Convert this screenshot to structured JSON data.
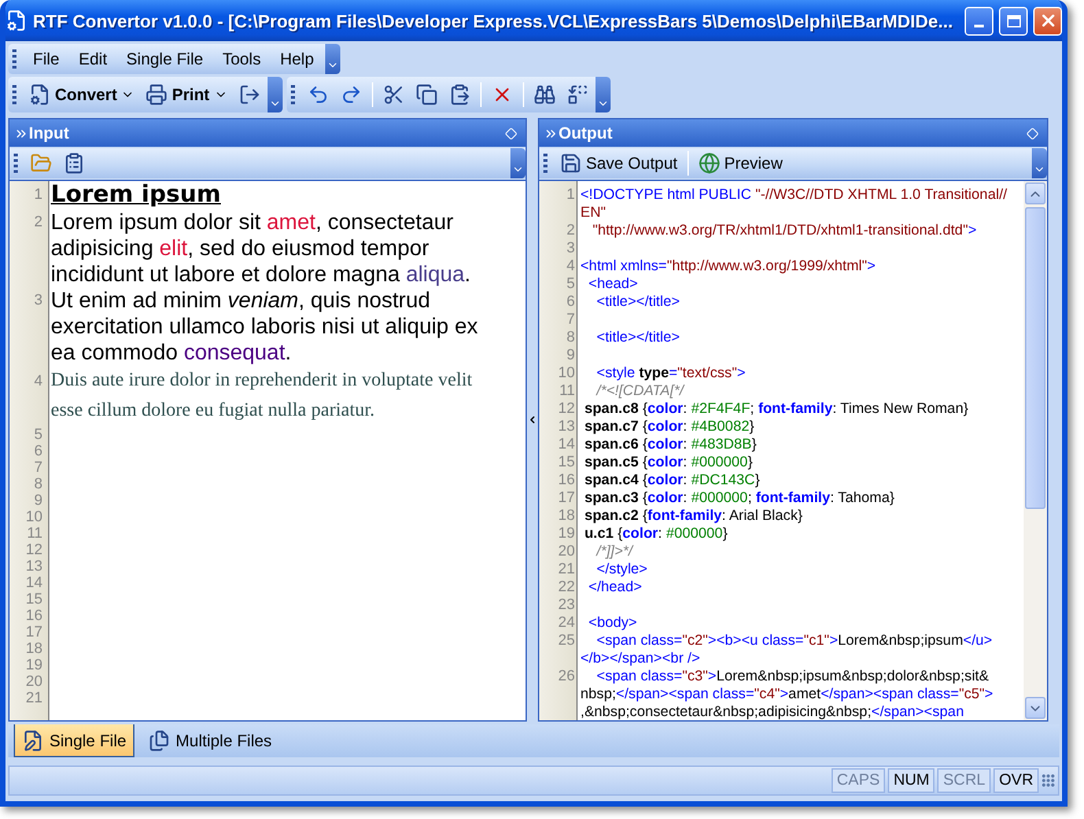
{
  "window": {
    "title": "RTF Convertor v1.0.0 - [C:\\Program Files\\Developer Express.VCL\\ExpressBars 5\\Demos\\Delphi\\EBarMDIDe..."
  },
  "menu": [
    "File",
    "Edit",
    "Single File",
    "Tools",
    "Help"
  ],
  "toolbar": [
    {
      "kind": "dropdown",
      "label": "Convert"
    },
    {
      "kind": "dropdown",
      "label": "Print"
    },
    {
      "kind": "icon"
    },
    {
      "kind": "separator"
    },
    {
      "kind": "icon"
    },
    {
      "kind": "icon"
    },
    {
      "kind": "separator"
    },
    {
      "kind": "icon"
    },
    {
      "kind": "icon"
    },
    {
      "kind": "icon"
    },
    {
      "kind": "separator"
    },
    {
      "kind": "icon"
    },
    {
      "kind": "separator"
    },
    {
      "kind": "icon"
    },
    {
      "kind": "icon"
    }
  ],
  "input": {
    "title": "Input",
    "paragraphs": [
      {
        "number": "1",
        "kind": "heading",
        "segments": [
          {
            "text": "Lorem ipsum",
            "color": "#000000",
            "italic": false
          }
        ]
      },
      {
        "number": "2",
        "kind": "sans",
        "segments": [
          {
            "text": "Lorem ipsum dolor sit ",
            "color": "#000000",
            "italic": false
          },
          {
            "text": "amet",
            "color": "#dc143c",
            "italic": false
          },
          {
            "text": ", consectetaur adipisicing ",
            "color": "#000000",
            "italic": false
          },
          {
            "text": "elit",
            "color": "#dc143c",
            "italic": false
          },
          {
            "text": ", sed do eiusmod tempor incididunt ut labore et dolore magna ",
            "color": "#000000",
            "italic": false
          },
          {
            "text": "aliqua",
            "color": "#483d8b",
            "italic": false
          },
          {
            "text": ".",
            "color": "#000000",
            "italic": false
          }
        ]
      },
      {
        "number": "3",
        "kind": "sans",
        "segments": [
          {
            "text": "Ut enim ad minim  ",
            "color": "#000000",
            "italic": false
          },
          {
            "text": "veniam",
            "color": "#000000",
            "italic": true
          },
          {
            "text": ", quis nostrud exercitation ullamco laboris nisi ut aliquip ex ea commodo ",
            "color": "#000000",
            "italic": false
          },
          {
            "text": "consequat",
            "color": "#4b0082",
            "italic": false
          },
          {
            "text": ".",
            "color": "#000000",
            "italic": false
          }
        ]
      },
      {
        "number": "4",
        "kind": "serif",
        "segments": [
          {
            "text": "Duis aute irure dolor in reprehenderit in voluptate velit esse cillum dolore eu fugiat nulla pariatur.",
            "color": "#2f4f4f",
            "italic": false
          }
        ]
      },
      {
        "number": "5",
        "kind": "empty"
      },
      {
        "number": "6",
        "kind": "empty"
      },
      {
        "number": "7",
        "kind": "empty"
      },
      {
        "number": "8",
        "kind": "empty"
      },
      {
        "number": "9",
        "kind": "empty"
      },
      {
        "number": "10",
        "kind": "empty"
      },
      {
        "number": "11",
        "kind": "empty"
      },
      {
        "number": "12",
        "kind": "empty"
      },
      {
        "number": "13",
        "kind": "empty"
      },
      {
        "number": "14",
        "kind": "empty"
      },
      {
        "number": "15",
        "kind": "empty"
      },
      {
        "number": "16",
        "kind": "empty"
      },
      {
        "number": "17",
        "kind": "empty"
      },
      {
        "number": "18",
        "kind": "empty"
      },
      {
        "number": "19",
        "kind": "empty"
      },
      {
        "number": "20",
        "kind": "empty"
      },
      {
        "number": "21",
        "kind": "empty"
      }
    ]
  },
  "output": {
    "title": "Output",
    "buttons": [
      {
        "label": "Save Output"
      },
      {
        "label": "Preview"
      }
    ],
    "rows": [
      {
        "number": "1",
        "tokens": [
          {
            "kind": "tag",
            "text": "<!DOCTYPE html PUBLIC "
          },
          {
            "kind": "value",
            "text": "\"-//W3C//DTD XHTML 1.0 Transitional//"
          }
        ]
      },
      {
        "tokens": [
          {
            "kind": "value",
            "text": "EN\""
          }
        ]
      },
      {
        "number": "2",
        "tokens": [
          {
            "kind": "value",
            "text": "   \"http://www.w3.org/TR/xhtml1/DTD/xhtml1-transitional.dtd\""
          },
          {
            "kind": "tag",
            "text": ">"
          }
        ]
      },
      {
        "number": "3"
      },
      {
        "number": "4",
        "tokens": [
          {
            "kind": "tag",
            "text": "<html xmlns="
          },
          {
            "kind": "value",
            "text": "\"http://www.w3.org/1999/xhtml\""
          },
          {
            "kind": "tag",
            "text": ">"
          }
        ]
      },
      {
        "number": "5",
        "tokens": [
          {
            "kind": "tag",
            "text": "  <head>"
          }
        ]
      },
      {
        "number": "6",
        "tokens": [
          {
            "kind": "tag",
            "text": "    <title></title>"
          }
        ]
      },
      {
        "number": "7"
      },
      {
        "number": "8",
        "tokens": [
          {
            "kind": "tag",
            "text": "    <title></title>"
          }
        ]
      },
      {
        "number": "9"
      },
      {
        "number": "10",
        "tokens": [
          {
            "kind": "tag",
            "text": "    <style "
          },
          {
            "kind": "attr",
            "text": "type"
          },
          {
            "kind": "tag",
            "text": "="
          },
          {
            "kind": "value",
            "text": "\"text/css\""
          },
          {
            "kind": "tag",
            "text": ">"
          }
        ]
      },
      {
        "number": "11",
        "tokens": [
          {
            "kind": "comment",
            "text": "    /*<![CDATA[*/"
          }
        ]
      },
      {
        "number": "12",
        "tokens": [
          {
            "kind": "attr",
            "text": " span.c8 "
          },
          {
            "kind": "text",
            "text": "{"
          },
          {
            "kind": "prop",
            "text": "color"
          },
          {
            "kind": "text",
            "text": ": "
          },
          {
            "kind": "number",
            "text": "#2F4F4F"
          },
          {
            "kind": "text",
            "text": "; "
          },
          {
            "kind": "prop",
            "text": "font-family"
          },
          {
            "kind": "text",
            "text": ": Times New Roman}"
          }
        ]
      },
      {
        "number": "13",
        "tokens": [
          {
            "kind": "attr",
            "text": " span.c7 "
          },
          {
            "kind": "text",
            "text": "{"
          },
          {
            "kind": "prop",
            "text": "color"
          },
          {
            "kind": "text",
            "text": ": "
          },
          {
            "kind": "number",
            "text": "#4B0082"
          },
          {
            "kind": "text",
            "text": "}"
          }
        ]
      },
      {
        "number": "14",
        "tokens": [
          {
            "kind": "attr",
            "text": " span.c6 "
          },
          {
            "kind": "text",
            "text": "{"
          },
          {
            "kind": "prop",
            "text": "color"
          },
          {
            "kind": "text",
            "text": ": "
          },
          {
            "kind": "number",
            "text": "#483D8B"
          },
          {
            "kind": "text",
            "text": "}"
          }
        ]
      },
      {
        "number": "15",
        "tokens": [
          {
            "kind": "attr",
            "text": " span.c5 "
          },
          {
            "kind": "text",
            "text": "{"
          },
          {
            "kind": "prop",
            "text": "color"
          },
          {
            "kind": "text",
            "text": ": "
          },
          {
            "kind": "number",
            "text": "#000000"
          },
          {
            "kind": "text",
            "text": "}"
          }
        ]
      },
      {
        "number": "16",
        "tokens": [
          {
            "kind": "attr",
            "text": " span.c4 "
          },
          {
            "kind": "text",
            "text": "{"
          },
          {
            "kind": "prop",
            "text": "color"
          },
          {
            "kind": "text",
            "text": ": "
          },
          {
            "kind": "number",
            "text": "#DC143C"
          },
          {
            "kind": "text",
            "text": "}"
          }
        ]
      },
      {
        "number": "17",
        "tokens": [
          {
            "kind": "attr",
            "text": " span.c3 "
          },
          {
            "kind": "text",
            "text": "{"
          },
          {
            "kind": "prop",
            "text": "color"
          },
          {
            "kind": "text",
            "text": ": "
          },
          {
            "kind": "number",
            "text": "#000000"
          },
          {
            "kind": "text",
            "text": "; "
          },
          {
            "kind": "prop",
            "text": "font-family"
          },
          {
            "kind": "text",
            "text": ": Tahoma}"
          }
        ]
      },
      {
        "number": "18",
        "tokens": [
          {
            "kind": "attr",
            "text": " span.c2 "
          },
          {
            "kind": "text",
            "text": "{"
          },
          {
            "kind": "prop",
            "text": "font-family"
          },
          {
            "kind": "text",
            "text": ": Arial Black}"
          }
        ]
      },
      {
        "number": "19",
        "tokens": [
          {
            "kind": "attr",
            "text": " u.c1 "
          },
          {
            "kind": "text",
            "text": "{"
          },
          {
            "kind": "prop",
            "text": "color"
          },
          {
            "kind": "text",
            "text": ": "
          },
          {
            "kind": "number",
            "text": "#000000"
          },
          {
            "kind": "text",
            "text": "}"
          }
        ]
      },
      {
        "number": "20",
        "tokens": [
          {
            "kind": "comment",
            "text": "    /*]]>*/"
          }
        ]
      },
      {
        "number": "21",
        "tokens": [
          {
            "kind": "tag",
            "text": "    </style>"
          }
        ]
      },
      {
        "number": "22",
        "tokens": [
          {
            "kind": "tag",
            "text": "  </head>"
          }
        ]
      },
      {
        "number": "23"
      },
      {
        "number": "24",
        "tokens": [
          {
            "kind": "tag",
            "text": "  <body>"
          }
        ]
      },
      {
        "number": "25",
        "tokens": [
          {
            "kind": "tag",
            "text": "    <span class="
          },
          {
            "kind": "value",
            "text": "\"c2\""
          },
          {
            "kind": "tag",
            "text": "><b><u class="
          },
          {
            "kind": "value",
            "text": "\"c1\""
          },
          {
            "kind": "tag",
            "text": ">"
          },
          {
            "kind": "text",
            "text": "Lorem&nbsp;ipsum"
          },
          {
            "kind": "tag",
            "text": "</u>"
          }
        ]
      },
      {
        "tokens": [
          {
            "kind": "tag",
            "text": "</b></span><br />"
          }
        ]
      },
      {
        "number": "26",
        "tokens": [
          {
            "kind": "tag",
            "text": "    <span class="
          },
          {
            "kind": "value",
            "text": "\"c3\""
          },
          {
            "kind": "tag",
            "text": ">"
          },
          {
            "kind": "text",
            "text": "Lorem&nbsp;ipsum&nbsp;dolor&nbsp;sit&"
          }
        ]
      },
      {
        "tokens": [
          {
            "kind": "text",
            "text": "nbsp;"
          },
          {
            "kind": "tag",
            "text": "</span><span class="
          },
          {
            "kind": "value",
            "text": "\"c4\""
          },
          {
            "kind": "tag",
            "text": ">"
          },
          {
            "kind": "text",
            "text": "amet"
          },
          {
            "kind": "tag",
            "text": "</span><span class="
          },
          {
            "kind": "value",
            "text": "\"c5\""
          },
          {
            "kind": "tag",
            "text": ">"
          }
        ]
      },
      {
        "tokens": [
          {
            "kind": "text",
            "text": ",&nbsp;consectetaur&nbsp;adipisicing&nbsp;"
          },
          {
            "kind": "tag",
            "text": "</span><span"
          }
        ]
      }
    ]
  },
  "tabs": [
    {
      "label": "Single File",
      "selected": true
    },
    {
      "label": "Multiple Files",
      "selected": false
    }
  ],
  "status_bar": [
    {
      "label": "CAPS",
      "disabled": true
    },
    {
      "label": "NUM",
      "disabled": false
    },
    {
      "label": "SCRL",
      "disabled": true
    },
    {
      "label": "OVR",
      "disabled": false
    }
  ]
}
